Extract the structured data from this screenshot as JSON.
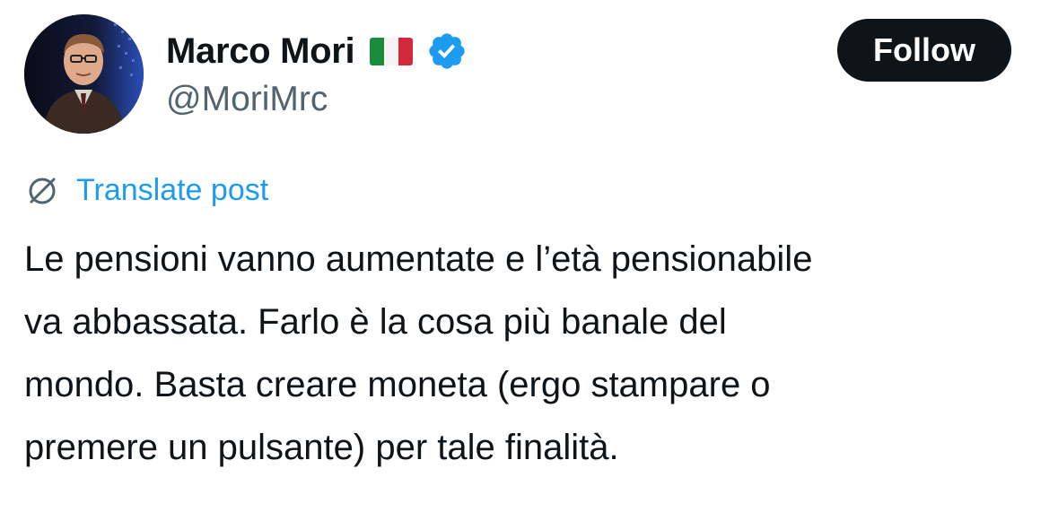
{
  "author": {
    "display_name": "Marco Mori",
    "handle": "@MoriMrc",
    "flag_icon": "italy-flag-icon",
    "verified_icon": "verified-badge-icon",
    "verified_color": "#1d9bf0"
  },
  "follow_button": {
    "label": "Follow"
  },
  "translate": {
    "icon": "globe-slash-icon",
    "label": "Translate post"
  },
  "post": {
    "lines": [
      "Le pensioni vanno aumentate e l’età pensionabile",
      "va abbassata. Farlo è la cosa più banale del",
      "mondo. Basta creare moneta (ergo stampare o",
      "premere un pulsante) per tale finalità."
    ]
  },
  "colors": {
    "text_primary": "#0f1419",
    "text_secondary": "#536471",
    "accent": "#1d9bf0",
    "button_bg": "#0f1419"
  }
}
